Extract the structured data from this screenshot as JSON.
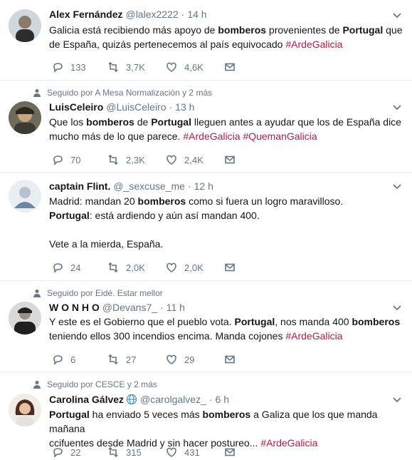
{
  "colors": {
    "hashtag": "#b41c46",
    "muted": "#657786",
    "text": "#14171a",
    "divider": "#e6ecf0"
  },
  "tweets": [
    {
      "social_context": "",
      "name": "Alex Fernández",
      "handle": "@lalex2222",
      "time": "14 h",
      "verified": false,
      "lines": [
        [
          "Galicia está recibiendo más apoyo de ",
          {
            "b": "bomberos"
          },
          " provenientes de ",
          {
            "b": "Portugal"
          },
          " que"
        ],
        [
          "de España, quizás pertenecemos al país equivocado ",
          {
            "h": "#ArdeGalicia"
          }
        ]
      ],
      "replies": "133",
      "retweets": "3,7K",
      "likes": "4,6K"
    },
    {
      "social_context": "Seguido por A Mesa Normalización y 2 más",
      "name": "LuisCeleiro",
      "handle": "@LuisCeleiro",
      "time": "13 h",
      "verified": false,
      "lines": [
        [
          "Que los ",
          {
            "b": "bomberos"
          },
          " de ",
          {
            "b": "Portugal"
          },
          " lleguen antes a ayudar que los de España dice"
        ],
        [
          "mucho más de lo que parece. ",
          {
            "h": "#ArdeGalicia"
          },
          " ",
          {
            "h": "#QuemanGalicia"
          }
        ]
      ],
      "replies": "70",
      "retweets": "2,3K",
      "likes": "2,4K"
    },
    {
      "social_context": "",
      "name": "captain Flint.",
      "handle": "@_sexcuse_me",
      "time": "12 h",
      "verified": false,
      "lines": [
        [
          "Madrid: mandan 20 ",
          {
            "b": "bomberos"
          },
          " como si fuera un logro maravilloso."
        ],
        [
          {
            "b": "Portugal"
          },
          ": está ardiendo y aún así mandan 400."
        ],
        [
          ""
        ],
        [
          "Vete a la mierda, España."
        ]
      ],
      "replies": "24",
      "retweets": "2,0K",
      "likes": "2,0K"
    },
    {
      "social_context": "Seguido por Eidé. Estar mellor",
      "name": "W O N H O",
      "handle": "@Devans7_",
      "time": "11 h",
      "verified": false,
      "lines": [
        [
          "Y este es el Gobierno que el pueblo vota. ",
          {
            "b": "Portugal"
          },
          ", nos manda 400 ",
          {
            "b": "bomberos"
          }
        ],
        [
          "teniendo ellos 300 incendios encima. Manda cojones ",
          {
            "h": "#ArdeGalicia"
          }
        ]
      ],
      "replies": "6",
      "retweets": "27",
      "likes": "29"
    },
    {
      "social_context": "Seguido por CESCE y 2 más",
      "name": "Carolina Gálvez",
      "handle": "@carolgalvez_",
      "time": "6 h",
      "verified": true,
      "lines": [
        [
          {
            "b": "Portugal"
          },
          " ha enviado 5 veces más ",
          {
            "b": "bomberos"
          },
          " a Galiza que los que manda mañana"
        ],
        [
          "ccifuentes desde Madrid y sin hacer postureo... ",
          {
            "h": "#ArdeGalicia"
          }
        ]
      ],
      "replies": "22",
      "retweets": "315",
      "likes": "431"
    }
  ]
}
